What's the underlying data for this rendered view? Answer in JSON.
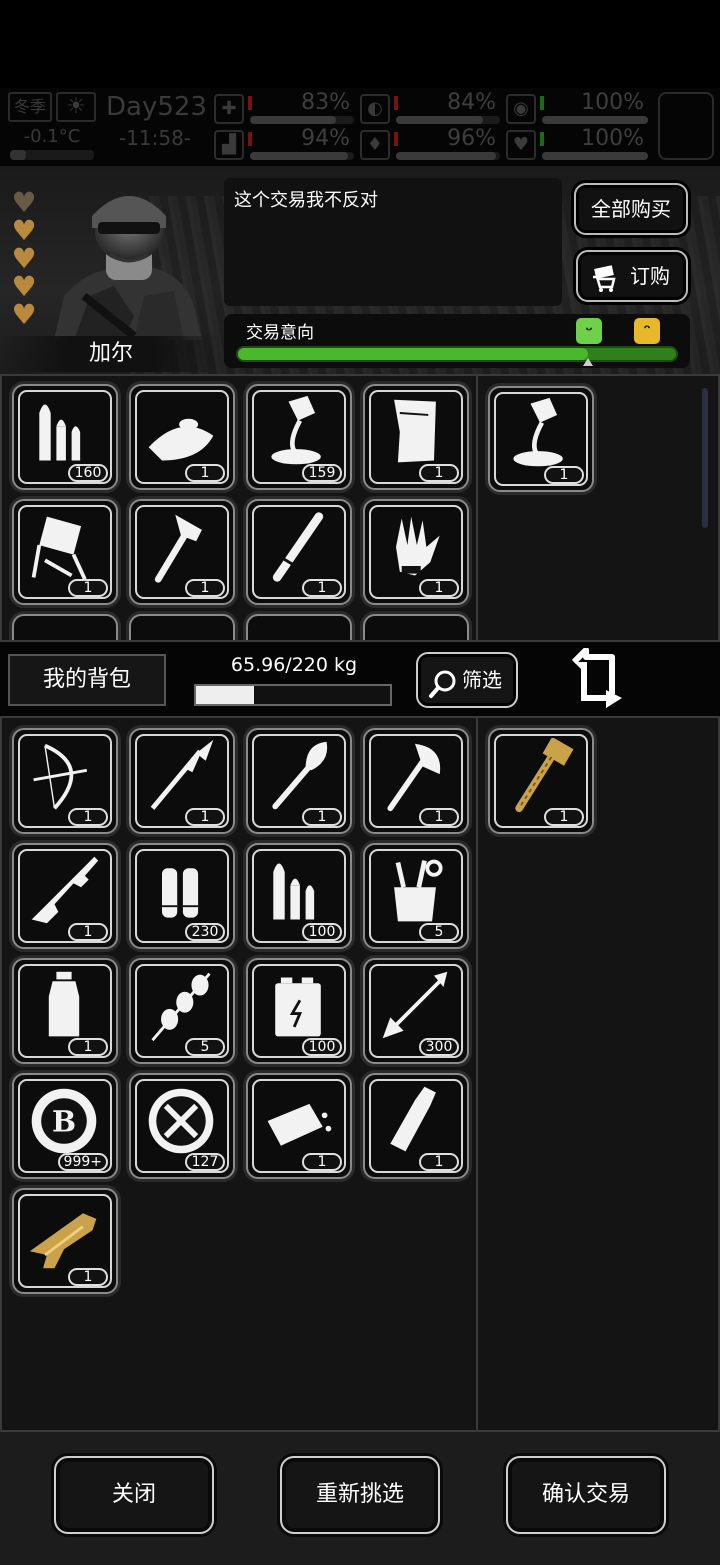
{
  "status": {
    "season": "冬季",
    "temperature": "-0.1°C",
    "day": "Day523",
    "time": "-11:58-",
    "stats": [
      {
        "icon": "medkit-icon",
        "value": "83%",
        "level": 0.83
      },
      {
        "icon": "stomach-icon",
        "value": "84%",
        "level": 0.84
      },
      {
        "icon": "brain-icon",
        "value": "100%",
        "level": 1.0
      },
      {
        "icon": "foot-icon",
        "value": "94%",
        "level": 0.94
      },
      {
        "icon": "water-drop-icon",
        "value": "96%",
        "level": 0.96
      },
      {
        "icon": "heart-icon",
        "value": "100%",
        "level": 1.0
      }
    ]
  },
  "trader": {
    "name": "加尔",
    "dialog": "这个交易我不反对",
    "buy_all_label": "全部购买",
    "order_label": "订购",
    "intent_label": "交易意向",
    "intent_level": 0.8,
    "hearts_filled": 4,
    "hearts_total": 5
  },
  "trader_items": [
    {
      "icon": "bullets-icon",
      "count": "160"
    },
    {
      "icon": "ufo-icon",
      "count": "1"
    },
    {
      "icon": "glue-tube-icon",
      "count": "159"
    },
    {
      "icon": "parchment-icon",
      "count": "1"
    },
    {
      "icon": "folding-chair-icon",
      "count": "1"
    },
    {
      "icon": "hatchet-icon",
      "count": "1"
    },
    {
      "icon": "baton-icon",
      "count": "1"
    },
    {
      "icon": "glove-icon",
      "count": "1"
    }
  ],
  "trader_offer": [
    {
      "icon": "glue-tube-icon",
      "count": "1"
    }
  ],
  "bag": {
    "label": "我的背包",
    "weight_text": "65.96/220 kg",
    "weight_level": 0.2998,
    "filter_label": "筛选"
  },
  "my_items": [
    {
      "icon": "bow-icon",
      "count": "1"
    },
    {
      "icon": "spear-icon",
      "count": "1"
    },
    {
      "icon": "shovel-icon",
      "count": "1"
    },
    {
      "icon": "axe-icon",
      "count": "1"
    },
    {
      "icon": "rifle-icon",
      "count": "1"
    },
    {
      "icon": "shotgun-shells-icon",
      "count": "230"
    },
    {
      "icon": "bullets-icon",
      "count": "100"
    },
    {
      "icon": "toolbox-icon",
      "count": "5"
    },
    {
      "icon": "water-bottle-icon",
      "count": "1"
    },
    {
      "icon": "skewer-icon",
      "count": "5"
    },
    {
      "icon": "battery-icon",
      "count": "100"
    },
    {
      "icon": "arrow-icon",
      "count": "300"
    },
    {
      "icon": "coin-icon",
      "count": "999+"
    },
    {
      "icon": "parts-token-icon",
      "count": "127"
    },
    {
      "icon": "bread-icon",
      "count": "1"
    },
    {
      "icon": "glass-bottle-icon",
      "count": "1"
    },
    {
      "icon": "golden-gun-icon",
      "count": "1"
    }
  ],
  "my_offer": [
    {
      "icon": "golden-hammer-icon",
      "count": "1"
    }
  ],
  "footer": {
    "close_label": "关闭",
    "reselect_label": "重新挑选",
    "confirm_label": "确认交易"
  }
}
